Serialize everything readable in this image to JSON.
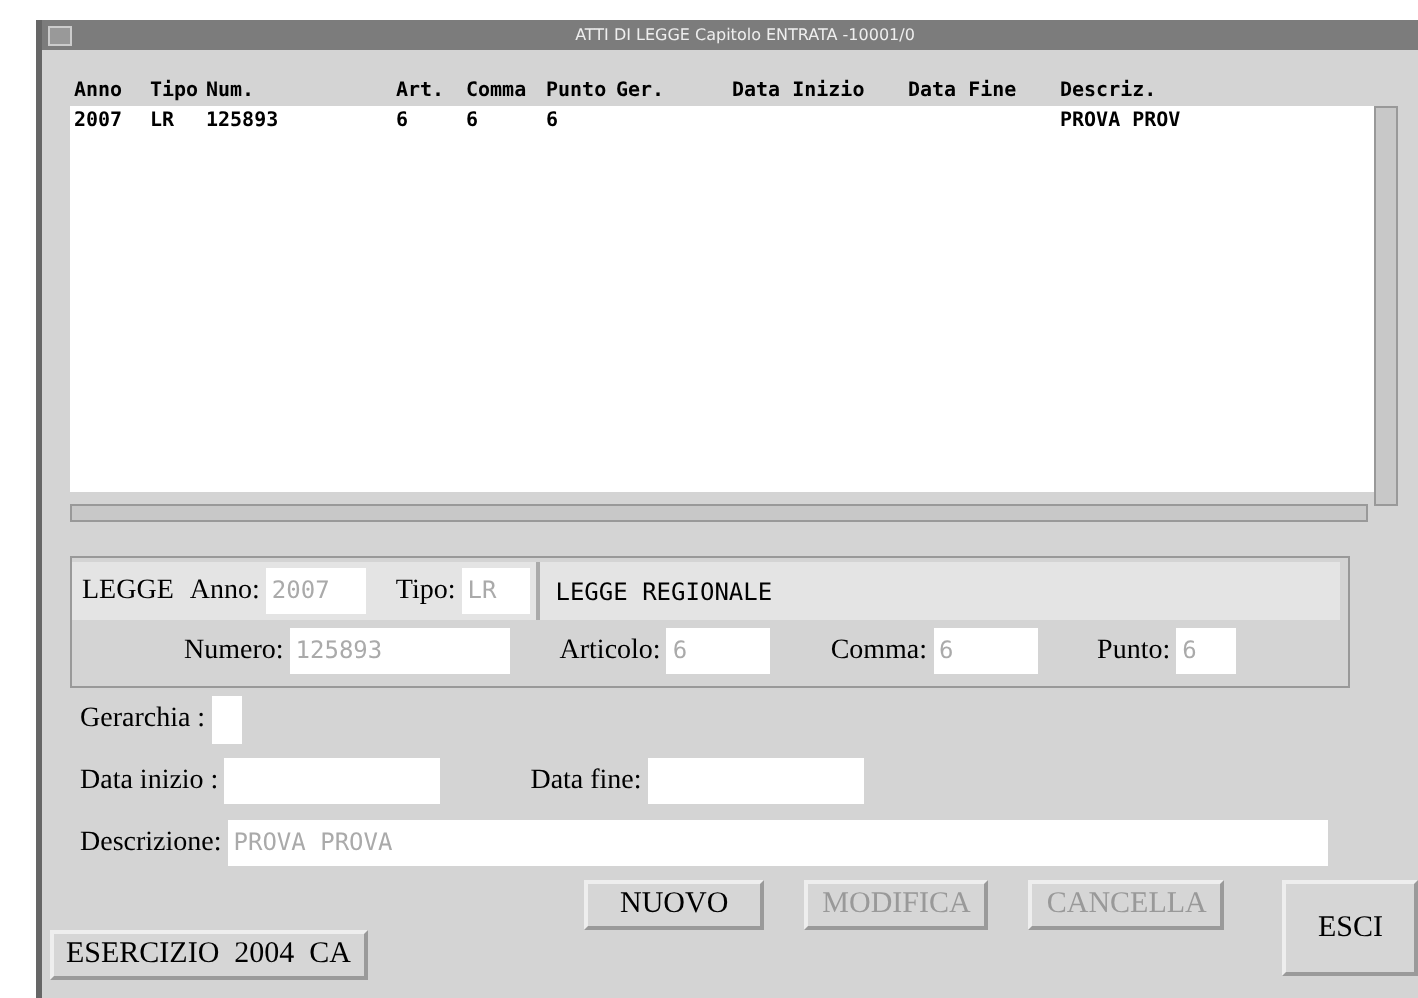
{
  "window": {
    "title": "ATTI DI LEGGE Capitolo ENTRATA -10001/0"
  },
  "table": {
    "columns": [
      "Anno",
      "Tipo",
      "Num.",
      "Art.",
      "Comma",
      "Punto",
      "Ger.",
      "Data Inizio",
      "Data Fine",
      "Descriz."
    ],
    "rows": [
      {
        "cells": [
          "2007",
          "LR",
          "125893",
          "6",
          "6",
          "6",
          "",
          "",
          "",
          "PROVA PROV"
        ],
        "selected": false
      }
    ]
  },
  "legge": {
    "label": "LEGGE",
    "anno_label": "Anno:",
    "anno": "2007",
    "tipo_label": "Tipo:",
    "tipo": "LR",
    "tipo_desc": "LEGGE REGIONALE",
    "numero_label": "Numero:",
    "numero": "125893",
    "articolo_label": "Articolo:",
    "articolo": "6",
    "comma_label": "Comma:",
    "comma": "6",
    "punto_label": "Punto:",
    "punto": "6"
  },
  "form": {
    "gerarchia_label": "Gerarchia :",
    "data_inizio_label": "Data inizio :",
    "data_fine_label": "Data fine:",
    "descrizione_label": "Descrizione:",
    "descrizione": "PROVA PROVA"
  },
  "buttons": [
    {
      "label": "NUOVO",
      "disabled": false
    },
    {
      "label": "MODIFICA",
      "disabled": true
    },
    {
      "label": "CANCELLA",
      "disabled": true
    }
  ],
  "exit_button": "ESCI",
  "status": "ESERCIZIO  2004  CA"
}
